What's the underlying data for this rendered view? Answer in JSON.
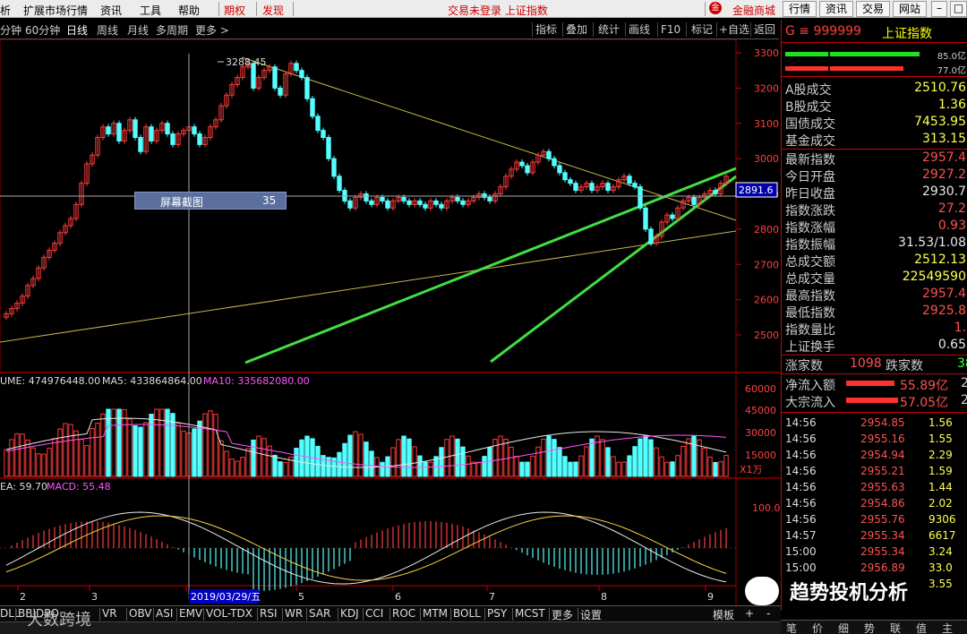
{
  "menubar": {
    "items": [
      "析",
      "扩展市场行情",
      "资讯",
      "工具",
      "帮助"
    ],
    "highlight": [
      "期权",
      "发现"
    ],
    "status": "交易未登录  上证指数",
    "shop": "金融商城",
    "buttons": [
      "行情",
      "资讯",
      "交易",
      "网站"
    ]
  },
  "period": {
    "items": [
      "分钟",
      "60分钟",
      "日线",
      "周线",
      "月线",
      "多周期",
      "更多 >"
    ],
    "active_index": 2,
    "tools": [
      "指标",
      "叠加",
      "统计",
      "画线",
      "F10",
      "标记",
      "+自选",
      "返回"
    ]
  },
  "quote": {
    "code": "G ≡ 999999",
    "name": "上证指数",
    "bar_top_value": "85.0亿",
    "bar_bottom_value": "77.0亿",
    "rows": [
      {
        "label": "A股成交",
        "value": "2510.76",
        "color": "yellow"
      },
      {
        "label": "B股成交",
        "value": "1.36",
        "color": "yellow"
      },
      {
        "label": "国债成交",
        "value": "7453.95",
        "color": "yellow"
      },
      {
        "label": "基金成交",
        "value": "313.15",
        "color": "yellow"
      }
    ],
    "stats": [
      {
        "label": "最新指数",
        "value": "2957.4",
        "color": "red"
      },
      {
        "label": "今日开盘",
        "value": "2927.2",
        "color": "red"
      },
      {
        "label": "昨日收盘",
        "value": "2930.7",
        "color": "white"
      },
      {
        "label": "指数涨跌",
        "value": "27.2",
        "color": "red"
      },
      {
        "label": "指数涨幅",
        "value": "0.93",
        "color": "red"
      },
      {
        "label": "指数振幅",
        "value": "31.53/1.08",
        "color": "white"
      },
      {
        "label": "总成交额",
        "value": "2512.13",
        "color": "yellow"
      },
      {
        "label": "总成交量",
        "value": "22549590",
        "color": "yellow"
      },
      {
        "label": "最高指数",
        "value": "2957.4",
        "color": "red"
      },
      {
        "label": "最低指数",
        "value": "2925.8",
        "color": "red"
      },
      {
        "label": "指数量比",
        "value": "1.",
        "color": "red"
      },
      {
        "label": "上证换手",
        "value": "0.65",
        "color": "white"
      }
    ],
    "updown": {
      "up_label": "涨家数",
      "up": "1098",
      "down_label": "跌家数",
      "down": "38"
    },
    "flows": [
      {
        "label": "净流入额",
        "value": "55.89亿",
        "extra": "2"
      },
      {
        "label": "大宗流入",
        "value": "57.05亿",
        "extra": "2"
      }
    ],
    "ticks": [
      {
        "time": "14:56",
        "price": "2954.85",
        "vol": "1.56"
      },
      {
        "time": "14:56",
        "price": "2955.16",
        "vol": "1.55"
      },
      {
        "time": "14:56",
        "price": "2954.94",
        "vol": "2.29"
      },
      {
        "time": "14:56",
        "price": "2955.21",
        "vol": "1.59"
      },
      {
        "time": "14:56",
        "price": "2955.63",
        "vol": "1.44"
      },
      {
        "time": "14:56",
        "price": "2954.86",
        "vol": "2.02"
      },
      {
        "time": "14:56",
        "price": "2955.76",
        "vol": "9306"
      },
      {
        "time": "14:57",
        "price": "2955.34",
        "vol": "6617"
      },
      {
        "time": "15:00",
        "price": "2955.34",
        "vol": "3.24"
      },
      {
        "time": "15:00",
        "price": "2956.89",
        "vol": "33.0"
      },
      {
        "time": "",
        "price": "",
        "vol": "3.55"
      }
    ],
    "tabs": [
      "笔",
      "价",
      "细",
      "势",
      "联",
      "值",
      "主"
    ]
  },
  "chart": {
    "price_axis": [
      "3300",
      "3200",
      "3100",
      "3000",
      "2900",
      "2800",
      "2700",
      "2600",
      "2500"
    ],
    "current_price": "2891.6",
    "high_label": "3288.45",
    "vol_axis": [
      "60000",
      "45000",
      "30000",
      "15000"
    ],
    "vol_unit": "X1万",
    "vol_legend": {
      "vol": "UME: 474976448.00",
      "ma5": "MA5: 433864864.00",
      "ma10": "MA10: 335682080.00"
    },
    "macd_axis": [
      "100.0"
    ],
    "macd_legend": {
      "dea": "EA: 59.70",
      "macd": "MACD: 55.48"
    },
    "dates": [
      "2",
      "3",
      "4",
      "5",
      "6",
      "7",
      "8",
      "9"
    ],
    "cursor_date": "2019/03/29/五",
    "screenshot_label": "屏幕截图",
    "screenshot_num": "35",
    "colors": {
      "up": "#ff3c3c",
      "down": "#54ffff",
      "trend": "#40e040",
      "ma5": "#e8e8e8",
      "ma10": "#ffd040"
    }
  },
  "bottombar": {
    "items": [
      "DLL",
      "BBI",
      "DPO",
      "VR",
      "OBV",
      "ASI",
      "EMV",
      "VOL-TDX",
      "RSI",
      "WR",
      "SAR",
      "KDJ",
      "CCI",
      "ROC",
      "MTM",
      "BOLL",
      "PSY",
      "MCST",
      "更多",
      "设置"
    ],
    "template": "模板",
    "plus": "+",
    "minus": "-"
  },
  "watermark": "趋势投机分析",
  "watermark2": "大数跨境"
}
